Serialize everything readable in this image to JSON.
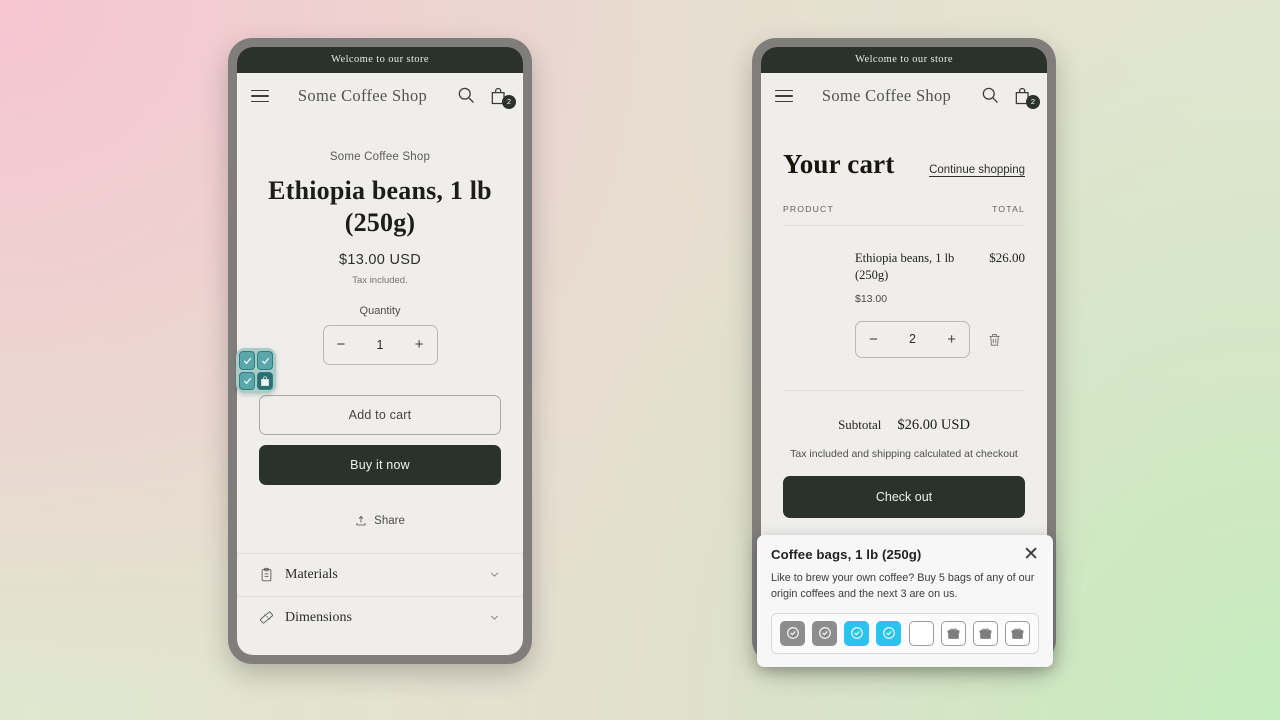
{
  "announcement": "Welcome to our store",
  "store": {
    "name": "Some Coffee Shop",
    "cart_count": "2",
    "menu_icon": "hamburger-icon",
    "search_icon": "search-icon",
    "cart_icon": "shopping-bag-icon"
  },
  "product": {
    "vendor": "Some Coffee Shop",
    "title": "Ethiopia beans, 1 lb (250g)",
    "price": "$13.00 USD",
    "tax_note": "Tax included.",
    "quantity_label": "Quantity",
    "quantity_value": "1",
    "decrease_label": "−",
    "increase_label": "+",
    "add_to_cart_label": "Add to cart",
    "buy_now_label": "Buy it now",
    "share_label": "Share",
    "accordion": [
      {
        "label": "Materials",
        "icon": "clipboard-icon"
      },
      {
        "label": "Dimensions",
        "icon": "ruler-icon"
      }
    ]
  },
  "teal_widget": {
    "cells": [
      {
        "icon": "check-icon",
        "state": "check"
      },
      {
        "icon": "check-icon",
        "state": "check"
      },
      {
        "icon": "check-icon",
        "state": "check"
      },
      {
        "icon": "shopping-bag-icon",
        "state": "bag"
      }
    ]
  },
  "cart": {
    "title": "Your cart",
    "continue_label": "Continue shopping",
    "col_product": "PRODUCT",
    "col_total": "TOTAL",
    "item": {
      "name": "Ethiopia beans, 1 lb (250g)",
      "unit_price": "$13.00",
      "line_total": "$26.00",
      "quantity": "2",
      "decrease_label": "−",
      "increase_label": "+",
      "remove_icon": "trash-icon"
    },
    "subtotal_label": "Subtotal",
    "subtotal_value": "$26.00 USD",
    "note": "Tax included and shipping calculated at checkout",
    "checkout_label": "Check out"
  },
  "popup": {
    "title": "Coffee bags, 1 lb (250g)",
    "description": "Like to brew your own coffee? Buy 5 bags of any of our origin coffees and the next 3 are on us.",
    "close_icon": "close-icon",
    "stamps": [
      {
        "state": "done",
        "icon": "check-circle-icon"
      },
      {
        "state": "done",
        "icon": "check-circle-icon"
      },
      {
        "state": "active",
        "icon": "check-circle-icon"
      },
      {
        "state": "active",
        "icon": "check-circle-icon"
      },
      {
        "state": "empty",
        "icon": "empty-slot-icon"
      },
      {
        "state": "gift",
        "icon": "gift-icon"
      },
      {
        "state": "gift",
        "icon": "gift-icon"
      },
      {
        "state": "gift",
        "icon": "gift-icon"
      }
    ]
  },
  "colors": {
    "dark": "#2b322d",
    "screen_bg": "#efeeec",
    "frame": "#807d7d",
    "accent_cyan": "#29c3ef",
    "teal": "#a9ccc6"
  }
}
